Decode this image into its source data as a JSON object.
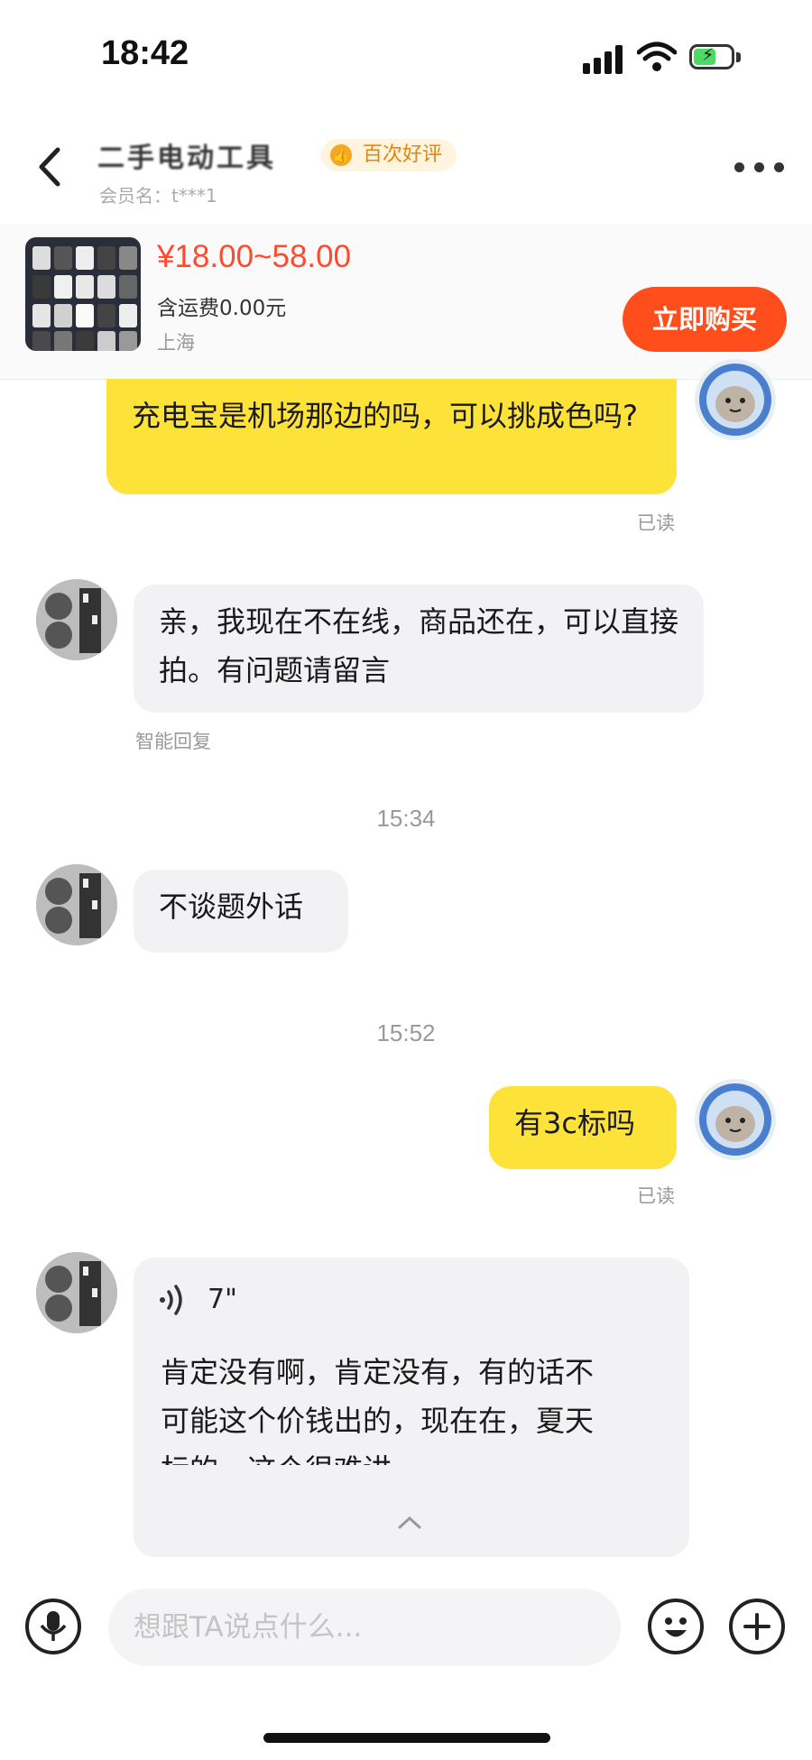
{
  "status_bar": {
    "time": "18:42"
  },
  "header": {
    "seller_name": "二手电动工具",
    "badge": "百次好评",
    "member_label": "会员名：t***1"
  },
  "product": {
    "price": "¥18.00~58.00",
    "shipping": "含运费0.00元",
    "location": "上海",
    "buy_label": "立即购买"
  },
  "messages": [
    {
      "text": "充电宝是机场那边的吗，可以挑成色吗?",
      "status": "已读"
    },
    {
      "text": "亲，我现在不在线，商品还在，可以直接拍。有问题请留言",
      "note": "智能回复"
    },
    {
      "time": "15:34"
    },
    {
      "text": "不谈题外话"
    },
    {
      "time": "15:52"
    },
    {
      "text": "有3c标吗",
      "status": "已读"
    },
    {
      "voice_duration": "7\"",
      "transcript_line1": "肯定没有啊，肯定没有，有的话不",
      "transcript_line2": "可能这个价钱出的，现在在，夏天",
      "transcript_line3": "标的，这个很难讲"
    }
  ],
  "input": {
    "placeholder": "想跟TA说点什么..."
  },
  "colors": {
    "accent_yellow": "#fde23a",
    "buy_orange": "#ff4e1c",
    "price_red": "#ff4a2e"
  }
}
